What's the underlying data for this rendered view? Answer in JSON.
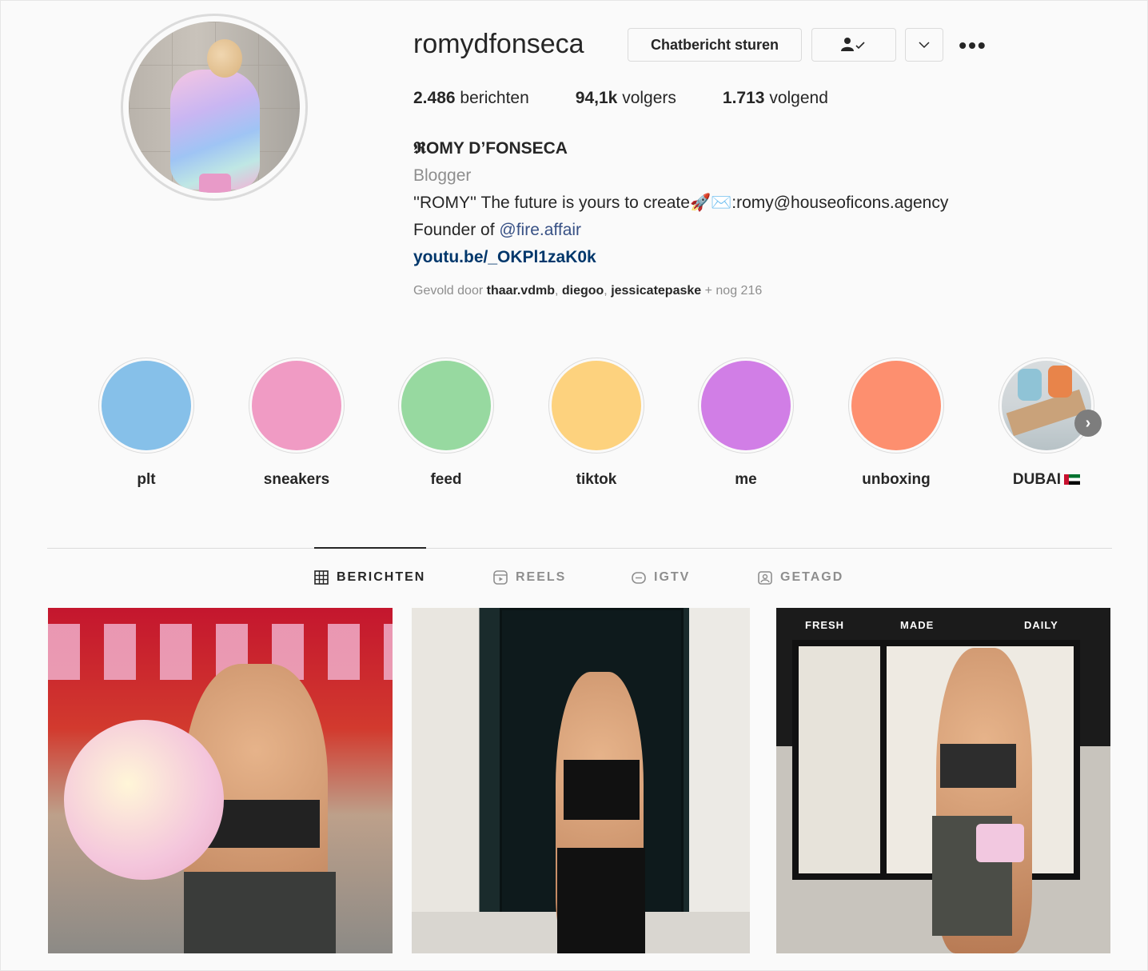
{
  "profile": {
    "username": "romydfonseca",
    "message_button": "Chatbericht sturen",
    "stats": [
      {
        "value": "2.486",
        "label": "berichten"
      },
      {
        "value": "94,1k",
        "label": "volgers"
      },
      {
        "value": "1.713",
        "label": "volgend"
      }
    ],
    "full_name": "𝕽OMY D’FONSECA",
    "category": "Blogger",
    "bio_line1": "''ROMY'' The future is yours to create🚀✉️:romy@houseoficons.agency",
    "bio_founder_prefix": "Founder of ",
    "bio_mention": "@fire.affair",
    "link": "youtu.be/_OKPl1zaK0k",
    "followed_prefix": "Gevold door ",
    "followed_users": [
      "thaar.vdmb",
      "diegoo",
      "jessicatepaske"
    ],
    "followed_suffix": " + nog 216"
  },
  "highlights": [
    {
      "label": "plt",
      "color": "#86c0e9"
    },
    {
      "label": "sneakers",
      "color": "#f09bc4"
    },
    {
      "label": "feed",
      "color": "#97d9a0"
    },
    {
      "label": "tiktok",
      "color": "#fdd27e"
    },
    {
      "label": "me",
      "color": "#d17ee6"
    },
    {
      "label": "unboxing",
      "color": "#fd8f6f"
    },
    {
      "label": "DUBAI",
      "color": "photo"
    }
  ],
  "tabs": [
    {
      "label": "BERICHTEN",
      "icon": "grid-icon",
      "active": true
    },
    {
      "label": "REELS",
      "icon": "reels-icon",
      "active": false
    },
    {
      "label": "IGTV",
      "icon": "igtv-icon",
      "active": false
    },
    {
      "label": "GETAGD",
      "icon": "tagged-icon",
      "active": false
    }
  ],
  "posts": [
    {
      "description": "cotton candy photo"
    },
    {
      "description": "door photo"
    },
    {
      "description": "fridge photo",
      "signs": [
        "FRESH",
        "MADE",
        "DAILY"
      ]
    }
  ]
}
